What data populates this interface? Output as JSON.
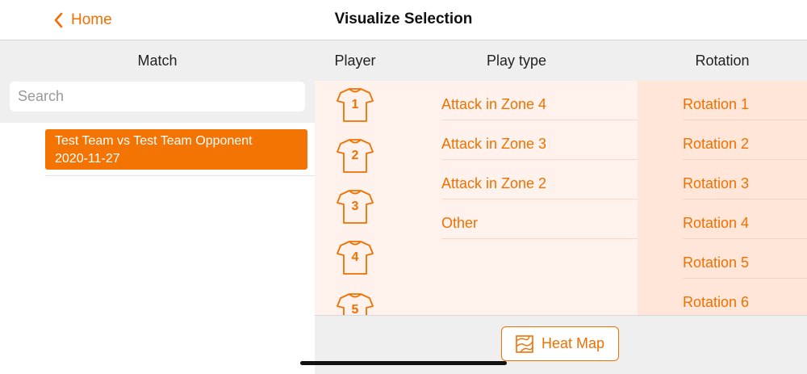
{
  "nav": {
    "back_label": "Home",
    "title": "Visualize Selection"
  },
  "headers": {
    "match": "Match",
    "player": "Player",
    "play_type": "Play type",
    "rotation": "Rotation"
  },
  "search": {
    "placeholder": "Search",
    "value": ""
  },
  "matches": [
    {
      "teams": "Test Team vs Test Team Opponent",
      "date": "2020-11-27",
      "selected": true
    }
  ],
  "players": [
    "1",
    "2",
    "3",
    "4",
    "5"
  ],
  "play_types": [
    "Attack in Zone 4",
    "Attack in Zone 3",
    "Attack in Zone 2",
    "Other"
  ],
  "rotations": [
    "Rotation 1",
    "Rotation 2",
    "Rotation 3",
    "Rotation 4",
    "Rotation 5",
    "Rotation 6"
  ],
  "actions": {
    "heat_map_label": "Heat Map"
  },
  "colors": {
    "accent": "#f47403",
    "panel_light": "#fff2ec",
    "panel_rotation": "#ffe6d8"
  },
  "icons": {
    "back": "chevron-left-icon",
    "player": "jersey-icon",
    "heat_map": "heat-map-icon"
  }
}
